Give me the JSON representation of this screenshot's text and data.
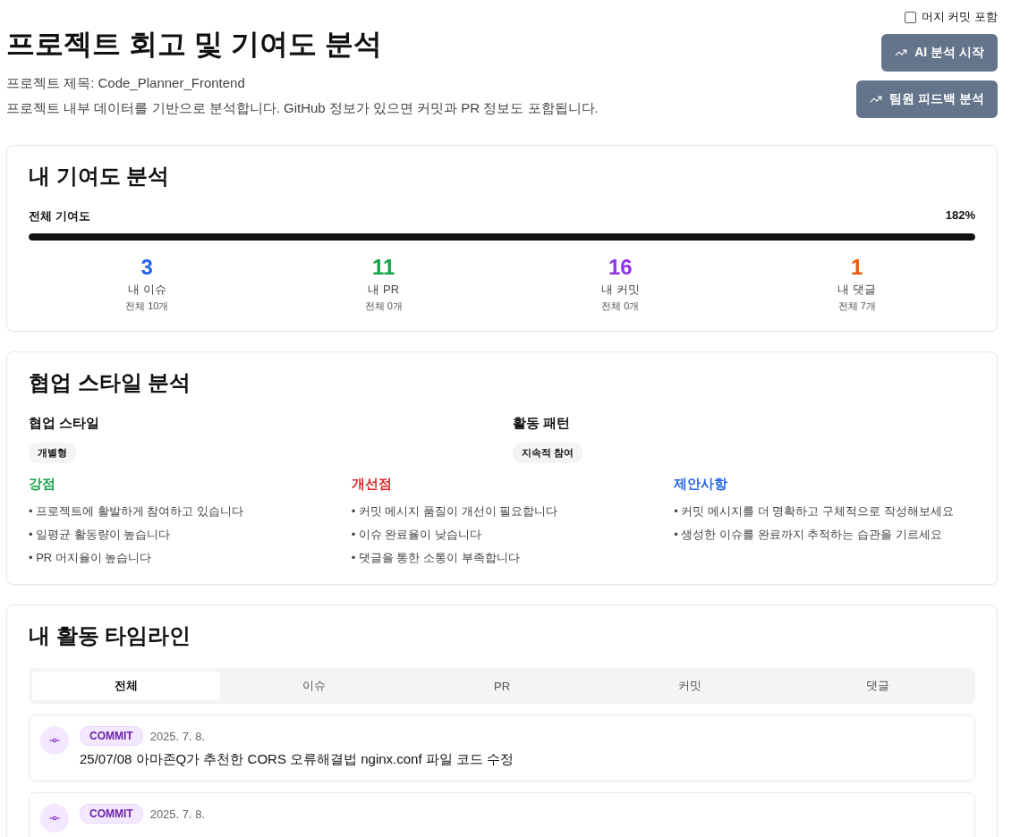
{
  "header": {
    "title": "프로젝트 회고 및 기여도 분석",
    "project_name": "프로젝트 제목: Code_Planner_Frontend",
    "description": "프로젝트 내부 데이터를 기반으로 분석합니다. GitHub 정보가 있으면 커밋과 PR 정보도 포함됩니다.",
    "merge_option": {
      "label": "머지 커밋 포함",
      "checked": false
    },
    "buttons": [
      "AI 분석 시작",
      "팀원 피드백 분석"
    ]
  },
  "contribution": {
    "title": "내 기여도 분석",
    "overall_label": "전체 기여도",
    "overall_value": "182%",
    "level": 1,
    "stats": [
      {
        "value": "3",
        "label": "내 이슈",
        "total": "전체 10개",
        "color": "#2563eb"
      },
      {
        "value": "11",
        "label": "내 PR",
        "total": "전체 0개",
        "color": "#16a34a"
      },
      {
        "value": "16",
        "label": "내 커밋",
        "total": "전체 0개",
        "color": "#9333ea"
      },
      {
        "value": "1",
        "label": "내 댓글",
        "total": "전체 7개",
        "color": "#ea580c"
      }
    ]
  },
  "collaboration": {
    "title": "협업 스타일 분석",
    "style": {
      "label": "협업 스타일",
      "tag": "개별형"
    },
    "pattern": {
      "label": "활동 패턴",
      "tag": "지속적 참여"
    },
    "columns": [
      {
        "title": "강점",
        "color": "#16a34a",
        "items": [
          "• 프로젝트에 활발하게 참여하고 있습니다",
          "• 일평균 활동량이 높습니다",
          "• PR 머지율이 높습니다"
        ]
      },
      {
        "title": "개선점",
        "color": "#dc2626",
        "items": [
          "• 커밋 메시지 품질이 개선이 필요합니다",
          "• 이슈 완료율이 낮습니다",
          "• 댓글을 통한 소통이 부족합니다"
        ]
      },
      {
        "title": "제안사항",
        "color": "#2563eb",
        "items": [
          "• 커밋 메시지를 더 명확하고 구체적으로 작성해보세요",
          "• 생성한 이슈를 완료까지 추적하는 습관을 기르세요"
        ]
      }
    ]
  },
  "timeline": {
    "title": "내 활동 타임라인",
    "tabs": [
      {
        "label": "전체",
        "selected": true
      },
      {
        "label": "이슈",
        "selected": false
      },
      {
        "label": "PR",
        "selected": false
      },
      {
        "label": "커밋",
        "selected": false
      },
      {
        "label": "댓글",
        "selected": false
      }
    ],
    "entries": [
      {
        "kind": "commit",
        "badge": "COMMIT",
        "date": "2025. 7. 8.",
        "message": "25/07/08 아마존Q가 추천한 CORS 오류해결법 nginx.conf 파일 코드 수정"
      },
      {
        "kind": "commit",
        "badge": "COMMIT",
        "date": "2025. 7. 8."
      }
    ]
  }
}
